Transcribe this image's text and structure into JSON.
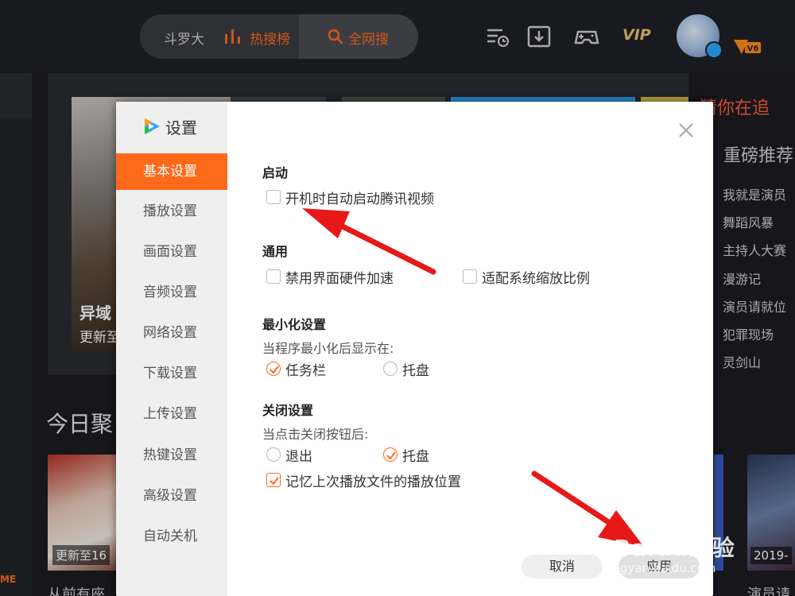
{
  "topbar": {
    "search_query": "斗罗大",
    "hot_label": "热搜榜",
    "all_search_label": "全网搜",
    "vip_label": "VIP"
  },
  "left_strip": {
    "me_label": "ME"
  },
  "banner": {
    "poster_title": "异域",
    "poster_update": "更新至"
  },
  "right_sidebar": {
    "title_guess": "猜你在追",
    "title_featured": "重磅推荐",
    "items": [
      "我就是演员",
      "舞蹈风暴",
      "主持人大赛",
      "漫游记",
      "演员请就位",
      "犯罪现场",
      "灵剑山"
    ]
  },
  "today": {
    "title": "今日聚",
    "tile1_label": "更新至16",
    "tile_right_label": "2019-",
    "bottom_caption": "从前有座",
    "bottom_caption_right": "演员请"
  },
  "dialog": {
    "title": "设置",
    "nav": [
      "基本设置",
      "播放设置",
      "画面设置",
      "音频设置",
      "网络设置",
      "下载设置",
      "上传设置",
      "热键设置",
      "高级设置",
      "自动关机"
    ],
    "active_nav_index": 0,
    "sections": {
      "startup": {
        "title": "启动",
        "auto_start": {
          "label": "开机时自动启动腾讯视频",
          "checked": false
        }
      },
      "general": {
        "title": "通用",
        "disable_hw_accel": {
          "label": "禁用界面硬件加速",
          "checked": false
        },
        "fit_system_scale": {
          "label": "适配系统缩放比例",
          "checked": false
        }
      },
      "minimize": {
        "title": "最小化设置",
        "desc": "当程序最小化后显示在:",
        "taskbar": {
          "label": "任务栏",
          "selected": true
        },
        "tray": {
          "label": "托盘",
          "selected": false
        }
      },
      "close": {
        "title": "关闭设置",
        "desc": "当点击关闭按钮后:",
        "exit": {
          "label": "退出",
          "selected": false
        },
        "tray": {
          "label": "托盘",
          "selected": true
        },
        "remember_position": {
          "label": "记忆上次播放文件的播放位置",
          "checked": true
        }
      }
    },
    "buttons": {
      "cancel": "取消",
      "apply": "应用"
    }
  },
  "watermark": {
    "brand": "Baidu经验",
    "url": "jingyan.baidu.com"
  },
  "colors": {
    "accent": "#ff6a1a",
    "arrow": "#e81818",
    "vip": "#e9c06f"
  }
}
